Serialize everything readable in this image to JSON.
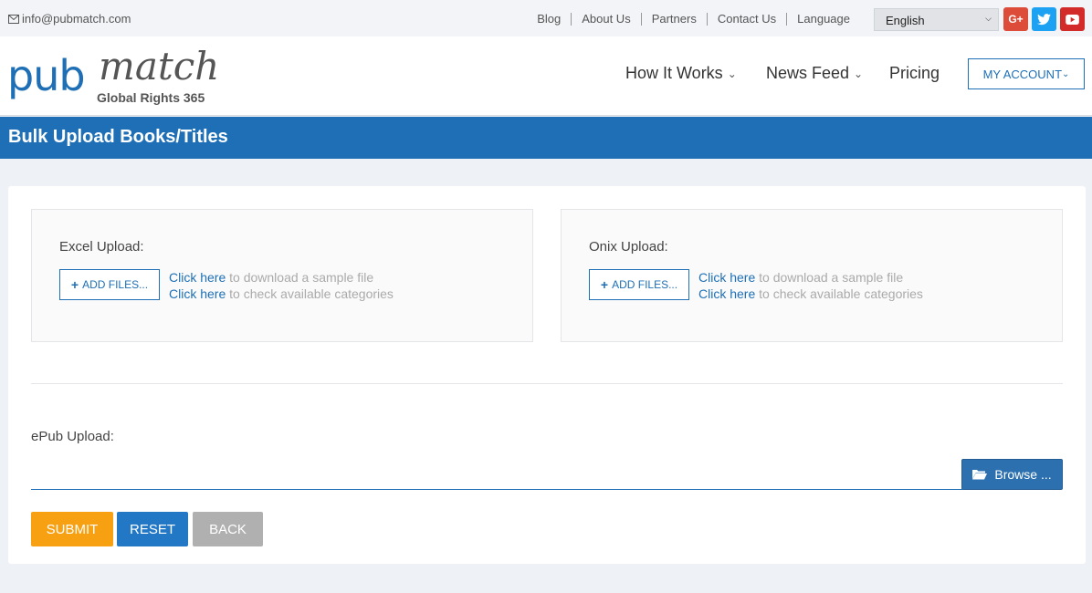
{
  "topbar": {
    "email": "info@pubmatch.com",
    "links": [
      "Blog",
      "About Us",
      "Partners",
      "Contact Us",
      "Language"
    ],
    "language_selected": "English",
    "social": {
      "gplus": "G+",
      "twitter": "t",
      "youtube": "▶"
    }
  },
  "header": {
    "logo_main": "pub",
    "logo_script": "match",
    "logo_tagline": "Global Rights 365",
    "nav": {
      "how_it_works": "How It Works",
      "news_feed": "News Feed",
      "pricing": "Pricing"
    },
    "my_account": "MY ACCOUNT"
  },
  "page": {
    "title": "Bulk Upload Books/Titles"
  },
  "excel": {
    "label": "Excel Upload:",
    "add_files": "ADD FILES...",
    "link1": "Click here",
    "text1": " to download a sample file",
    "link2": "Click here",
    "text2": " to check available categories"
  },
  "onix": {
    "label": "Onix Upload:",
    "add_files": "ADD FILES...",
    "link1": "Click here",
    "text1": " to download a sample file",
    "link2": "Click here",
    "text2": " to check available categories"
  },
  "epub": {
    "label": "ePub Upload:",
    "browse": "Browse ..."
  },
  "actions": {
    "submit": "SUBMIT",
    "reset": "RESET",
    "back": "BACK"
  },
  "colors": {
    "primary": "#1e6fb5",
    "submit": "#f7a012",
    "back": "#b0b0b0"
  }
}
